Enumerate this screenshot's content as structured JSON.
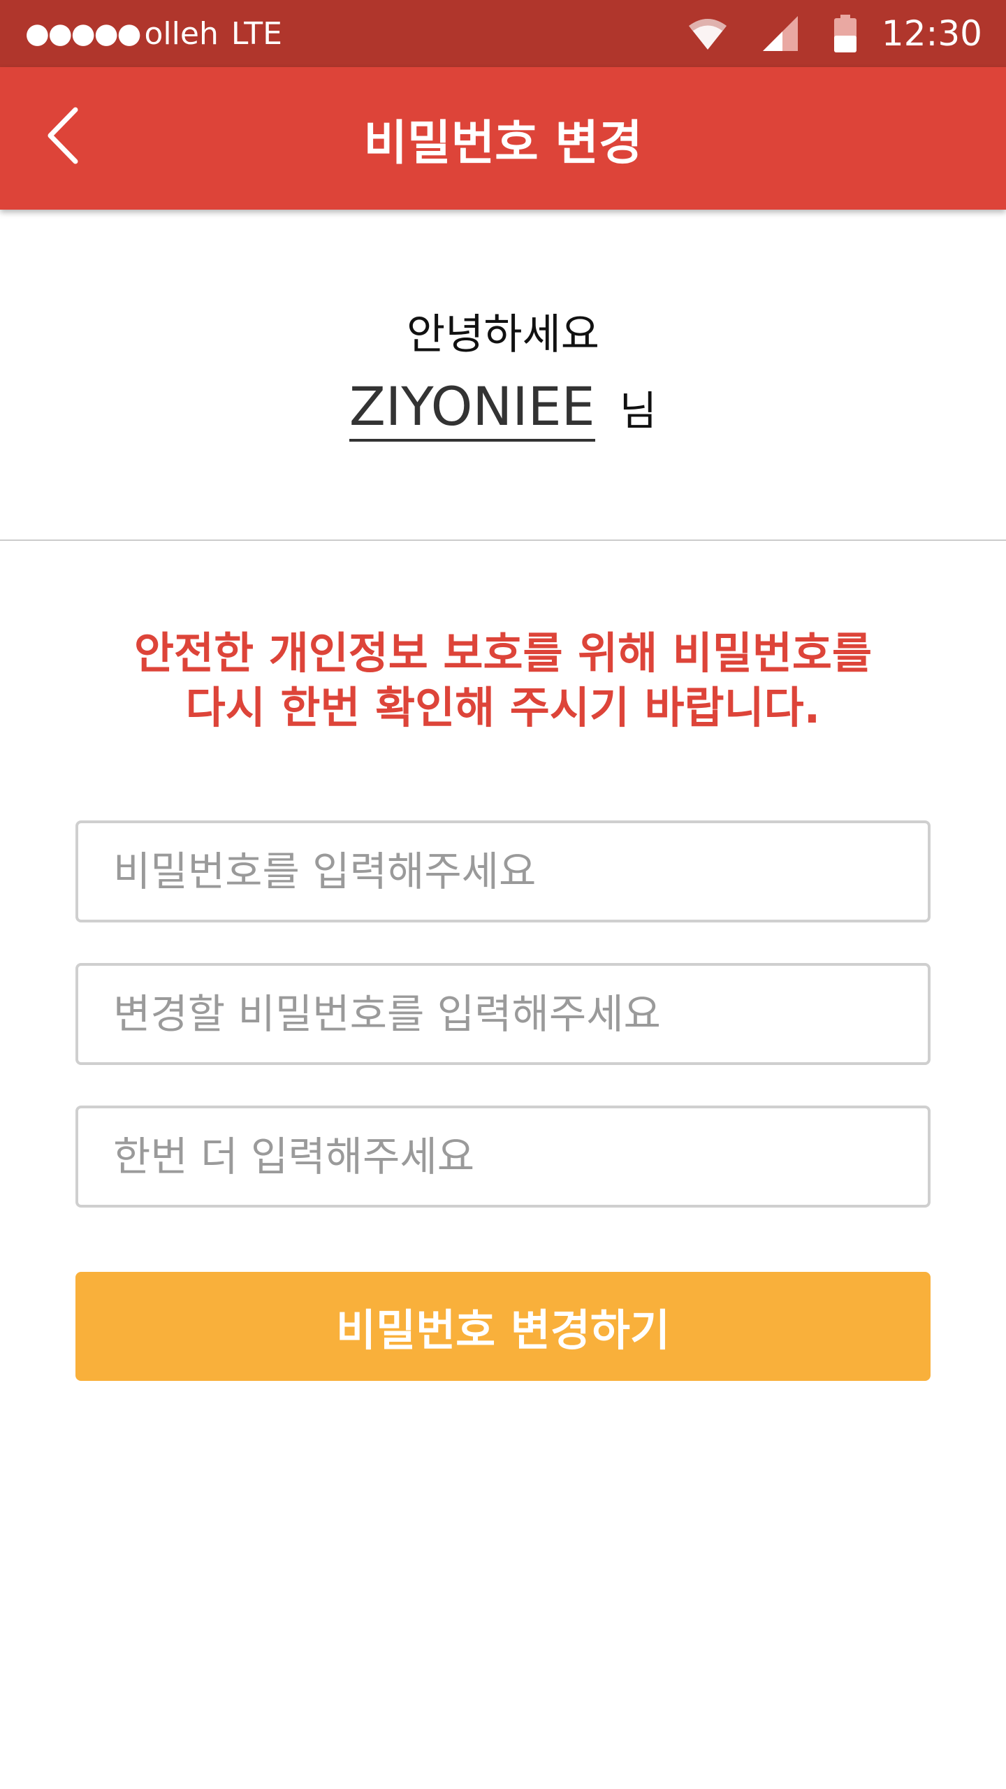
{
  "status_bar": {
    "signal_dots": "●●●●●",
    "carrier": "olleh",
    "network": "LTE",
    "time": "12:30",
    "icons": [
      "wifi-icon",
      "cellular-signal-icon",
      "battery-icon"
    ]
  },
  "app_bar": {
    "back_icon": "chevron-left-icon",
    "title": "비밀번호 변경"
  },
  "greeting": {
    "hello": "안녕하세요",
    "username": "ZIYONIEE",
    "honorific": "님"
  },
  "notice": {
    "line1": "안전한 개인정보 보호를 위해 비밀번호를",
    "line2": "다시 한번 확인해 주시기 바랍니다."
  },
  "form": {
    "current_password": {
      "value": "",
      "placeholder": "비밀번호를 입력해주세요"
    },
    "new_password": {
      "value": "",
      "placeholder": "변경할 비밀번호를 입력해주세요"
    },
    "confirm_password": {
      "value": "",
      "placeholder": "한번 더 입력해주세요"
    },
    "submit_label": "비밀번호 변경하기"
  },
  "colors": {
    "status_bar_bg": "#b0362c",
    "app_bar_bg": "#dd4439",
    "notice_text": "#dd4439",
    "submit_bg": "#f9b03b",
    "input_border": "#cfcfcf",
    "placeholder": "#9a9a9a"
  }
}
